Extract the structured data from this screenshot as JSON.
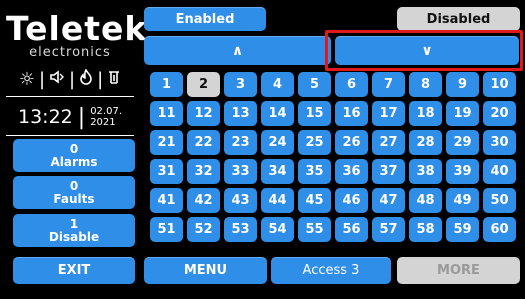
{
  "logo": {
    "brand": "Teletek",
    "sub": "electronics"
  },
  "status": {
    "icons": [
      "sun-icon",
      "speaker-icon",
      "flame-icon",
      "bell-icon"
    ]
  },
  "clock": {
    "time": "13:22",
    "date_top": "02.07.",
    "date_bottom": "2021"
  },
  "side": {
    "alarms": {
      "count": "0",
      "label": "Alarms"
    },
    "faults": {
      "count": "0",
      "label": "Faults"
    },
    "disable": {
      "count": "1",
      "label": "Disable"
    }
  },
  "top": {
    "enabled": "Enabled",
    "disabled": "Disabled",
    "up_glyph": "∧",
    "down_glyph": "∨"
  },
  "grid": {
    "selected": "2",
    "numbers": [
      "1",
      "2",
      "3",
      "4",
      "5",
      "6",
      "7",
      "8",
      "9",
      "10",
      "11",
      "12",
      "13",
      "14",
      "15",
      "16",
      "17",
      "18",
      "19",
      "20",
      "21",
      "22",
      "23",
      "24",
      "25",
      "26",
      "27",
      "28",
      "29",
      "30",
      "31",
      "32",
      "33",
      "34",
      "35",
      "36",
      "37",
      "38",
      "39",
      "40",
      "41",
      "42",
      "43",
      "44",
      "45",
      "46",
      "47",
      "48",
      "49",
      "50",
      "51",
      "52",
      "53",
      "54",
      "55",
      "56",
      "57",
      "58",
      "59",
      "60"
    ]
  },
  "bottom": {
    "exit": "EXIT",
    "menu": "MENU",
    "access": "Access 3",
    "more": "MORE"
  },
  "colors": {
    "blue": "#2f8ee8",
    "gray": "#d4d4d4",
    "highlight": "#e01a1a"
  }
}
